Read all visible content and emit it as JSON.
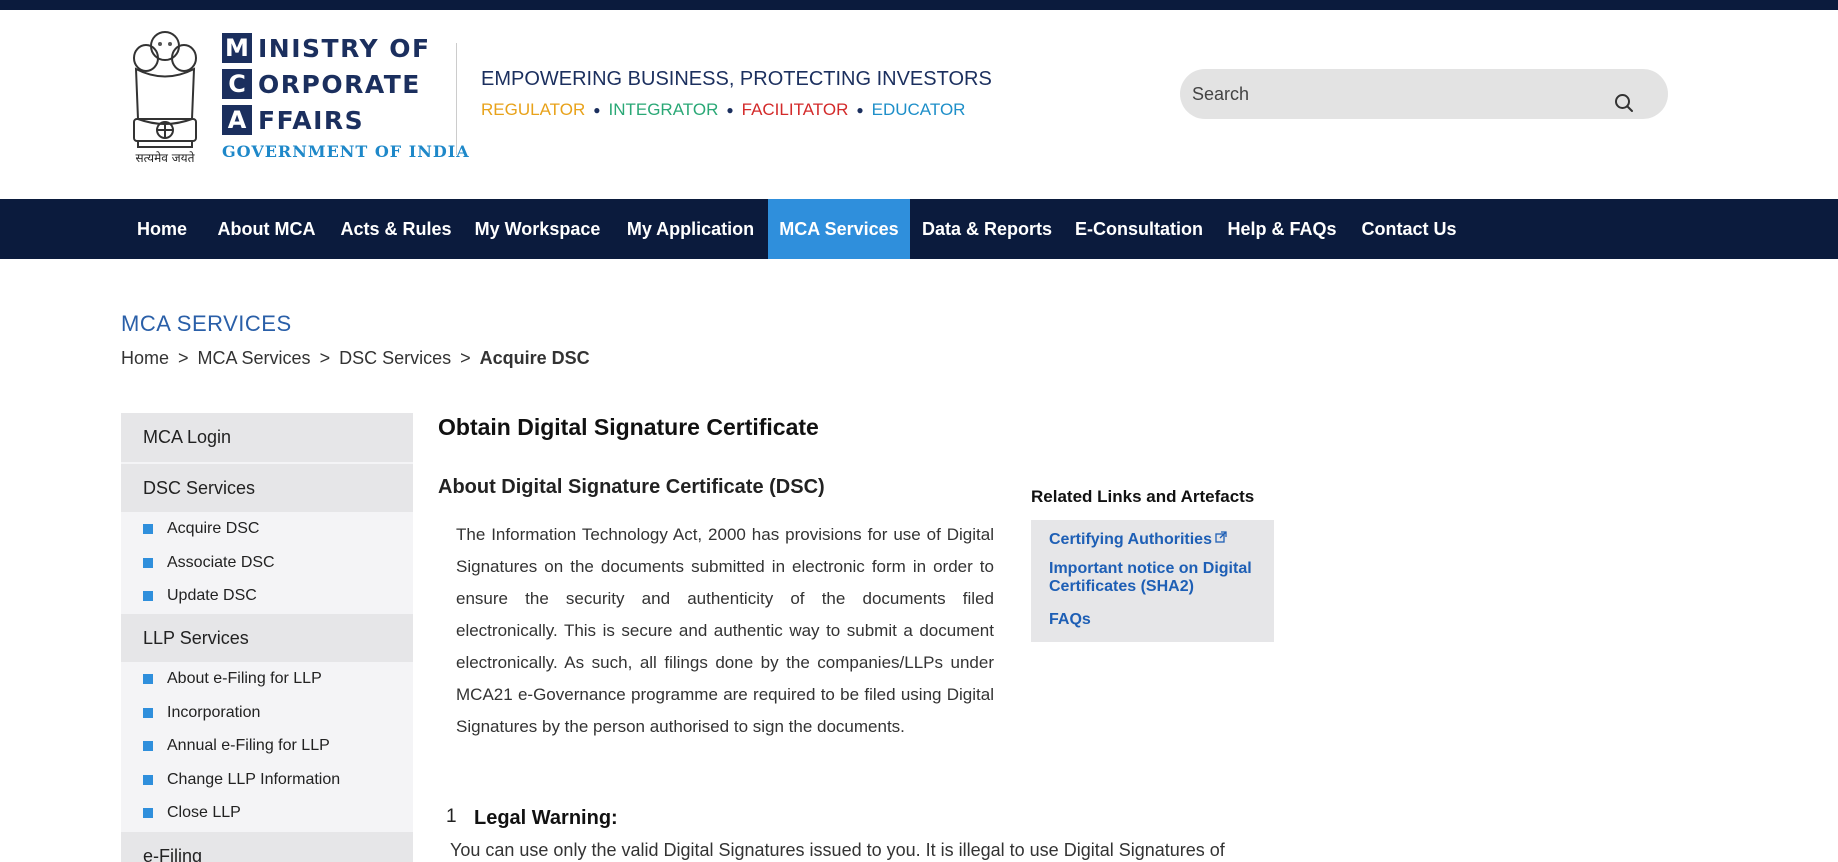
{
  "header": {
    "emblem_caption": "सत्यमेव जयते",
    "logo": {
      "rows": [
        {
          "letter": "M",
          "word": "INISTRY OF"
        },
        {
          "letter": "C",
          "word": "ORPORATE"
        },
        {
          "letter": "A",
          "word": "FFAIRS"
        }
      ],
      "subtitle": "GOVERNMENT OF INDIA"
    },
    "tagline": "EMPOWERING BUSINESS, PROTECTING INVESTORS",
    "roles": [
      {
        "label": "REGULATOR",
        "color": "#e8a21a"
      },
      {
        "label": "INTEGRATOR",
        "color": "#2aa876"
      },
      {
        "label": "FACILITATOR",
        "color": "#d32a2a"
      },
      {
        "label": "EDUCATOR",
        "color": "#1e8fc9"
      }
    ],
    "role_separator": "●",
    "search": {
      "placeholder": "Search",
      "icon": "search-icon"
    }
  },
  "nav": {
    "items": [
      {
        "label": "Home",
        "active": false
      },
      {
        "label": "About MCA",
        "active": false
      },
      {
        "label": "Acts & Rules",
        "active": false
      },
      {
        "label": "My Workspace",
        "active": false
      },
      {
        "label": "My Application",
        "active": false
      },
      {
        "label": "MCA Services",
        "active": true
      },
      {
        "label": "Data & Reports",
        "active": false
      },
      {
        "label": "E-Consultation",
        "active": false
      },
      {
        "label": "Help & FAQs",
        "active": false
      },
      {
        "label": "Contact Us",
        "active": false
      }
    ],
    "active_color": "#2f8fdc",
    "bar_color": "#0b1b3d"
  },
  "page": {
    "title": "MCA SERVICES",
    "breadcrumb": [
      "Home",
      "MCA Services",
      "DSC Services",
      "Acquire DSC"
    ],
    "breadcrumb_separator": ">"
  },
  "sidebar": {
    "sections": [
      {
        "label": "MCA Login",
        "items": []
      },
      {
        "label": "DSC Services",
        "items": [
          "Acquire DSC",
          "Associate DSC",
          "Update DSC"
        ]
      },
      {
        "label": "LLP Services",
        "items": [
          "About e-Filing for LLP",
          "Incorporation",
          "Annual e-Filing for LLP",
          "Change LLP Information",
          "Close LLP"
        ]
      },
      {
        "label": "e-Filing",
        "items": []
      }
    ]
  },
  "main": {
    "title": "Obtain Digital Signature Certificate",
    "section_title": "About Digital Signature Certificate (DSC)",
    "paragraph": "The Information Technology Act, 2000 has provisions for use of Digital Signatures on the documents submitted in electronic form in order to ensure the security and authenticity of the documents filed electronically. This is secure and authentic way to submit a document electronically. As such, all filings done by the companies/LLPs under MCA21 e-Governance programme are required to be filed using Digital Signatures by the person authorised to sign the documents.",
    "legal": {
      "number": "1",
      "title": "Legal Warning:",
      "text": "You can use only the valid Digital Signatures issued to you. It is illegal to use Digital Signatures of"
    }
  },
  "related": {
    "title": "Related Links and Artefacts",
    "links": [
      {
        "label": "Certifying Authorities",
        "external": true
      },
      {
        "label": "Important notice on Digital Certificates (SHA2)",
        "external": false
      },
      {
        "label": "FAQs",
        "external": false
      }
    ]
  }
}
